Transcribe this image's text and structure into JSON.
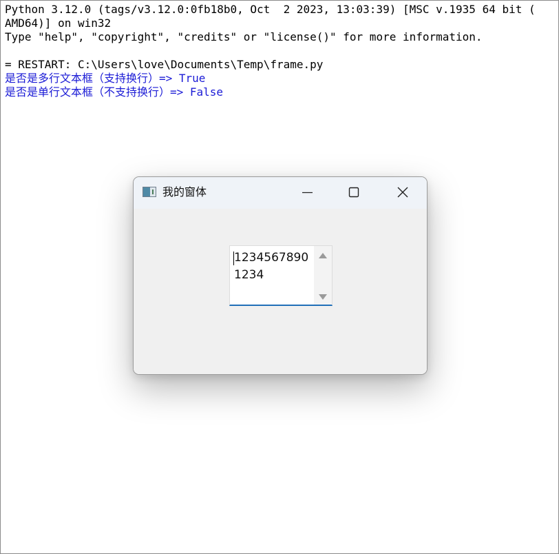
{
  "shell": {
    "lines": [
      "Python 3.12.0 (tags/v3.12.0:0fb18b0, Oct  2 2023, 13:03:39) [MSC v.1935 64 bit (",
      "AMD64)] on win32",
      "Type \"help\", \"copyright\", \"credits\" or \"license()\" for more information.",
      "",
      "= RESTART: C:\\Users\\love\\Documents\\Temp\\frame.py"
    ],
    "output": [
      "是否是多行文本框（支持换行）=> True",
      "是否是单行文本框（不支持换行）=> False"
    ],
    "output_color": "#1b1bd6"
  },
  "window": {
    "title": "我的窗体",
    "icon": "app-window-icon",
    "controls": {
      "minimize": "minimize-icon",
      "maximize": "maximize-icon",
      "close": "close-icon"
    }
  },
  "textbox": {
    "lines": [
      "1234567890",
      "1234"
    ],
    "focus_color": "#1f6fb8",
    "scroll_up": "arrow-up-icon",
    "scroll_down": "arrow-down-icon"
  }
}
